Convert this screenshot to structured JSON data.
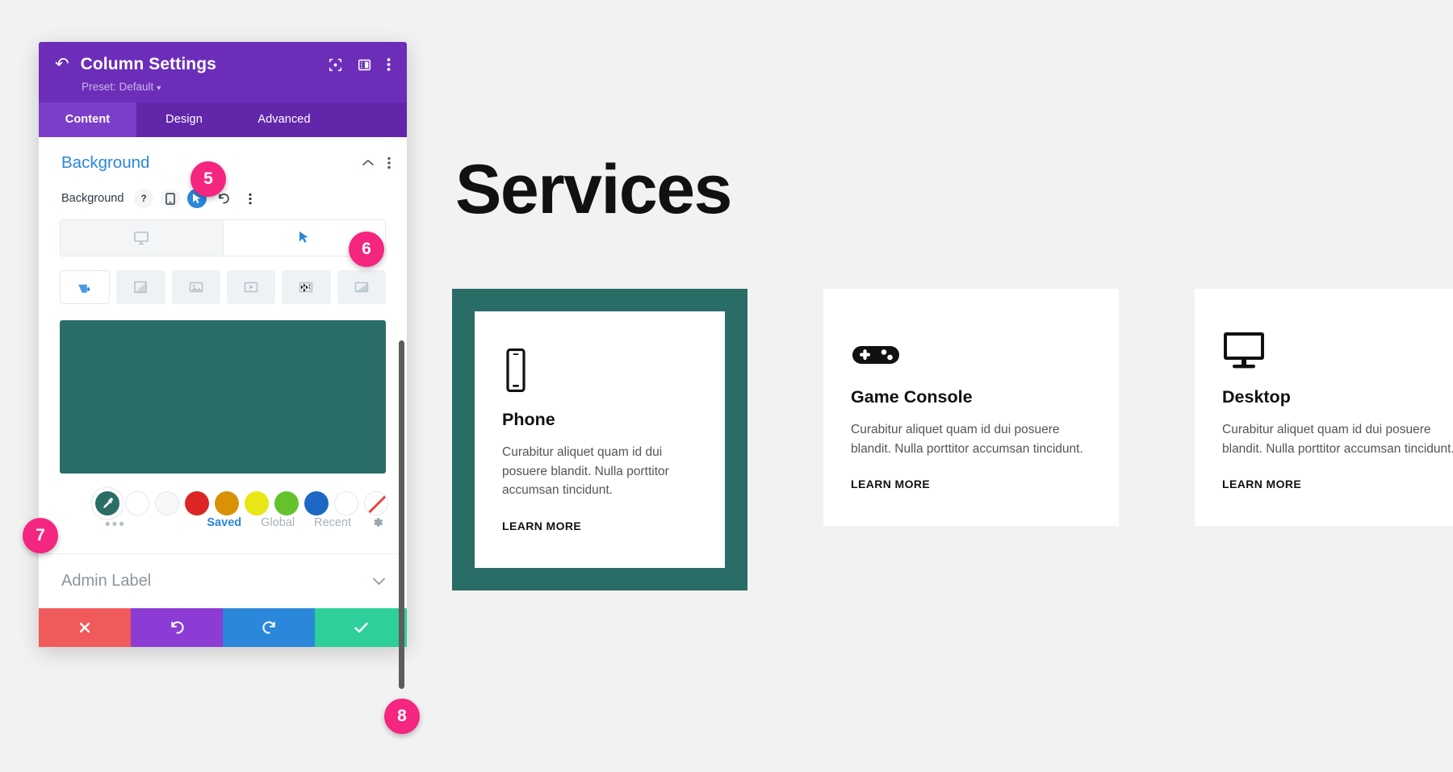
{
  "panel": {
    "title": "Column Settings",
    "back_icon": "back-arrow-icon",
    "preset_label": "Preset: Default",
    "header_icons": [
      "focus-target-icon",
      "layout-panel-icon",
      "kebab-menu-icon"
    ],
    "tabs": [
      {
        "label": "Content",
        "active": true
      },
      {
        "label": "Design",
        "active": false
      },
      {
        "label": "Advanced",
        "active": false
      }
    ],
    "section": {
      "title": "Background",
      "collapse_icon": "chevron-up-icon",
      "menu_icon": "kebab-menu-icon"
    },
    "field": {
      "label": "Background",
      "icons": [
        {
          "name": "help-icon",
          "glyph": "?",
          "active": false
        },
        {
          "name": "responsive-mobile-icon",
          "glyph": "mobile",
          "active": false
        },
        {
          "name": "hover-cursor-icon",
          "glyph": "cursor",
          "active": true
        },
        {
          "name": "reset-icon",
          "glyph": "reset",
          "active": false
        },
        {
          "name": "kebab-menu-icon",
          "glyph": "kebab",
          "active": false
        }
      ]
    },
    "state_tabs": [
      {
        "name": "desktop-state-tab",
        "icon": "desktop-monitor-icon",
        "active": false
      },
      {
        "name": "hover-state-tab",
        "icon": "cursor-pointer-icon",
        "active": true
      }
    ],
    "bg_types": [
      {
        "name": "background-color-type",
        "icon": "paint-bucket-icon",
        "active": true
      },
      {
        "name": "background-gradient-type",
        "icon": "gradient-icon",
        "active": false
      },
      {
        "name": "background-image-type",
        "icon": "image-icon",
        "active": false
      },
      {
        "name": "background-video-type",
        "icon": "video-play-icon",
        "active": false
      },
      {
        "name": "background-pattern-type",
        "icon": "pattern-grid-icon",
        "active": false
      },
      {
        "name": "background-mask-type",
        "icon": "mask-shape-icon",
        "active": false
      }
    ],
    "selected_color": "#2a6d66",
    "swatches": [
      {
        "name": "swatch-selected-teal",
        "color": "#2a6d66",
        "selected": true,
        "eyedropper": true
      },
      {
        "name": "swatch-white",
        "color": "#ffffff",
        "outline": true
      },
      {
        "name": "swatch-offwhite",
        "color": "#f7f8f9",
        "outline": true
      },
      {
        "name": "swatch-red",
        "color": "#dc2626"
      },
      {
        "name": "swatch-orange",
        "color": "#d99106"
      },
      {
        "name": "swatch-yellow",
        "color": "#e9e615"
      },
      {
        "name": "swatch-green",
        "color": "#64c32c"
      },
      {
        "name": "swatch-blue",
        "color": "#1c68c4"
      },
      {
        "name": "swatch-white2",
        "color": "#ffffff",
        "outline": true
      },
      {
        "name": "swatch-no-color",
        "color": "none",
        "none": true
      }
    ],
    "more_swatches_label": "•••",
    "palette_tabs": [
      {
        "label": "Saved",
        "active": true
      },
      {
        "label": "Global",
        "active": false
      },
      {
        "label": "Recent",
        "active": false
      }
    ],
    "palette_settings_icon": "gear-icon",
    "admin_label": {
      "text": "Admin Label",
      "icon": "chevron-down-icon"
    },
    "footer_buttons": [
      {
        "name": "cancel-button",
        "icon": "close-x-icon",
        "color": "#f15a5a"
      },
      {
        "name": "undo-button",
        "icon": "undo-arrow-icon",
        "color": "#8c3bd4"
      },
      {
        "name": "redo-button",
        "icon": "redo-arrow-icon",
        "color": "#2b87da"
      },
      {
        "name": "save-button",
        "icon": "checkmark-icon",
        "color": "#2ecf9a"
      }
    ]
  },
  "callouts": [
    {
      "number": "5",
      "target": "background-section-title"
    },
    {
      "number": "6",
      "target": "hover-state-tab"
    },
    {
      "number": "7",
      "target": "selected-color-swatch"
    },
    {
      "number": "8",
      "target": "save-button"
    }
  ],
  "preview": {
    "heading": "Services",
    "cards": [
      {
        "icon": "phone-icon",
        "title": "Phone",
        "body": "Curabitur aliquet quam id dui posuere blandit. Nulla porttitor accumsan tincidunt.",
        "link": "LEARN MORE",
        "highlighted": true,
        "highlight_color": "#2a6d66"
      },
      {
        "icon": "game-controller-icon",
        "title": "Game Console",
        "body": "Curabitur aliquet quam id dui posuere blandit. Nulla porttitor accumsan tincidunt.",
        "link": "LEARN MORE",
        "highlighted": false
      },
      {
        "icon": "desktop-monitor-icon",
        "title": "Desktop",
        "body": "Curabitur aliquet quam id dui posuere blandit. Nulla porttitor accumsan tincidunt.",
        "link": "LEARN MORE",
        "highlighted": false
      }
    ]
  }
}
